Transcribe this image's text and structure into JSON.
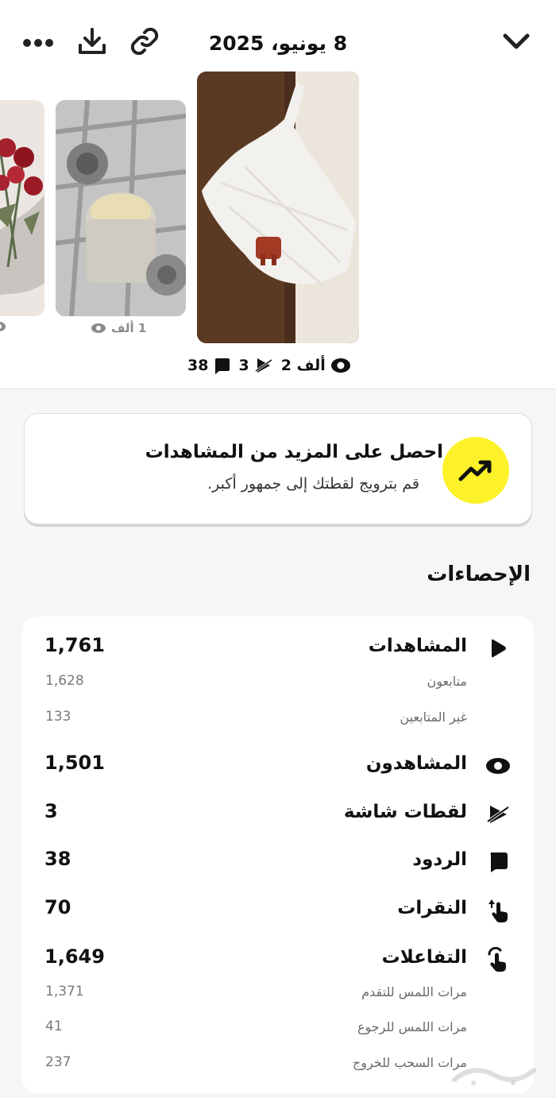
{
  "header": {
    "date": "8 يونيو، 2025",
    "icons": [
      "chevron-down-icon",
      "link-icon",
      "download-icon",
      "more-icon"
    ]
  },
  "thumbnails": [
    {
      "caption": "1 ألف",
      "icon": "eye-icon"
    }
  ],
  "selected_story": {
    "views": "2 ألف",
    "screenshots": "3",
    "replies": "38"
  },
  "promo": {
    "title": "احصل على المزيد من المشاهدات",
    "subtitle": "قم بترويج لقطتك إلى جمهور أكبر.",
    "accent": "#fdf12a"
  },
  "section_title": "الإحصاءات",
  "metrics": {
    "views": {
      "label": "المشاهدات",
      "value": "1,761"
    },
    "followers": {
      "label": "متابعون",
      "value": "1,628"
    },
    "non_followers": {
      "label": "غير المتابعين",
      "value": "133"
    },
    "viewers": {
      "label": "المشاهدون",
      "value": "1,501"
    },
    "screenshots": {
      "label": "لقطات شاشة",
      "value": "3"
    },
    "replies": {
      "label": "الردود",
      "value": "38"
    },
    "taps": {
      "label": "النقرات",
      "value": "70"
    },
    "interactions": {
      "label": "التفاعلات",
      "value": "1,649"
    },
    "tap_forward": {
      "label": "مرات اللمس للتقدم",
      "value": "1,371"
    },
    "tap_back": {
      "label": "مرات اللمس للرجوع",
      "value": "41"
    },
    "swipe_exit": {
      "label": "مرات السحب للخروج",
      "value": "237"
    }
  }
}
